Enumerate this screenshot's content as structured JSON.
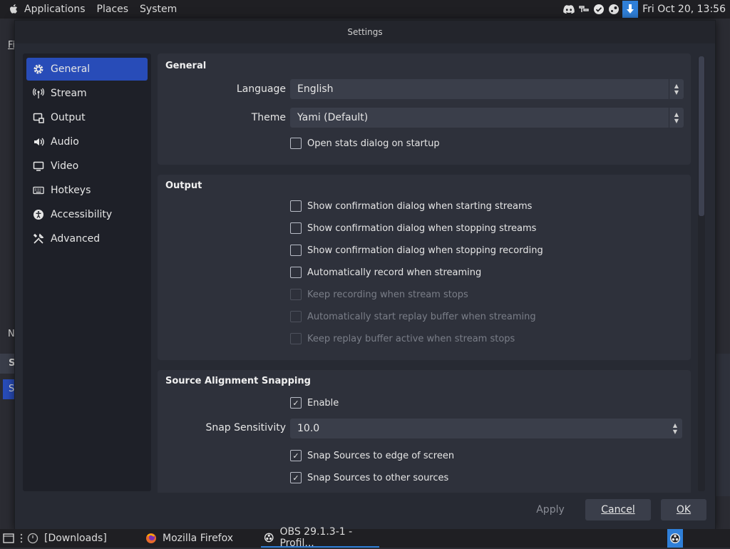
{
  "top_panel": {
    "menus": [
      "Applications",
      "Places",
      "System"
    ],
    "clock": "Fri Oct 20, 13:56"
  },
  "background": {
    "frag_fi": "Fi",
    "frag_n": "N",
    "frag_s1": "S",
    "frag_s2": "S"
  },
  "dialog": {
    "title": "Settings",
    "sidebar": [
      {
        "label": "General",
        "icon": "gear-icon"
      },
      {
        "label": "Stream",
        "icon": "antenna-icon"
      },
      {
        "label": "Output",
        "icon": "output-icon"
      },
      {
        "label": "Audio",
        "icon": "speaker-icon"
      },
      {
        "label": "Video",
        "icon": "monitor-icon"
      },
      {
        "label": "Hotkeys",
        "icon": "keyboard-icon"
      },
      {
        "label": "Accessibility",
        "icon": "accessibility-icon"
      },
      {
        "label": "Advanced",
        "icon": "tools-icon"
      }
    ],
    "general": {
      "title": "General",
      "language_label": "Language",
      "language_value": "English",
      "theme_label": "Theme",
      "theme_value": "Yami (Default)",
      "open_stats": "Open stats dialog on startup"
    },
    "output": {
      "title": "Output",
      "items": [
        "Show confirmation dialog when starting streams",
        "Show confirmation dialog when stopping streams",
        "Show confirmation dialog when stopping recording",
        "Automatically record when streaming",
        "Keep recording when stream stops",
        "Automatically start replay buffer when streaming",
        "Keep replay buffer active when stream stops"
      ]
    },
    "snapping": {
      "title": "Source Alignment Snapping",
      "enable": "Enable",
      "sensitivity_label": "Snap Sensitivity",
      "sensitivity_value": "10.0",
      "edge": "Snap Sources to edge of screen",
      "other": "Snap Sources to other sources"
    },
    "buttons": {
      "apply": "Apply",
      "cancel": "Cancel",
      "ok": "OK"
    }
  },
  "taskbar": {
    "downloads": "[Downloads]",
    "firefox": "Mozilla Firefox",
    "obs": "OBS 29.1.3-1 - Profil..."
  },
  "colors": {
    "accent": "#284cb8",
    "panel": "#1f1f23",
    "dialog_bg": "#272a33",
    "group_bg": "#2e313b"
  }
}
